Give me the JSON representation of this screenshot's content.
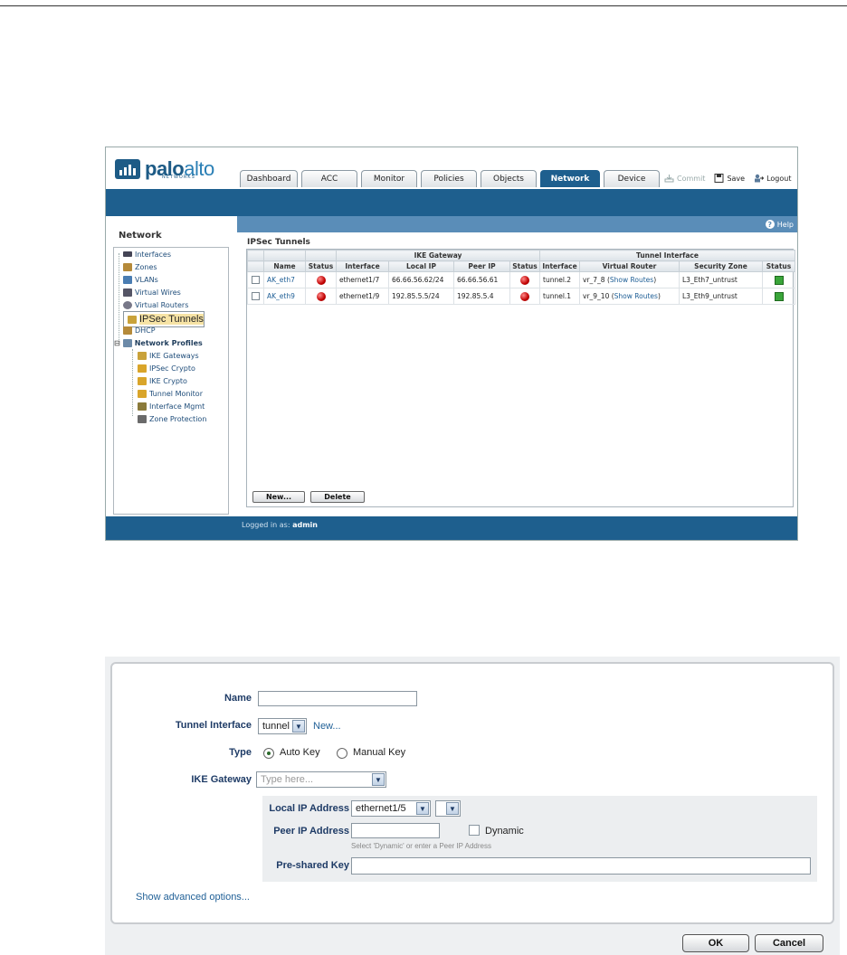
{
  "app": {
    "logo_main": "palo",
    "logo_accent": "alto",
    "logo_sub": "NETWORKS"
  },
  "tabs": [
    {
      "label": "Dashboard"
    },
    {
      "label": "ACC"
    },
    {
      "label": "Monitor"
    },
    {
      "label": "Policies"
    },
    {
      "label": "Objects"
    },
    {
      "label": "Network",
      "active": true
    },
    {
      "label": "Device"
    }
  ],
  "actions": {
    "commit": "Commit",
    "save": "Save",
    "logout": "Logout"
  },
  "help": "Help",
  "sidebar": {
    "title": "Network",
    "items": [
      {
        "label": "Interfaces"
      },
      {
        "label": "Zones"
      },
      {
        "label": "VLANs"
      },
      {
        "label": "Virtual Wires"
      },
      {
        "label": "Virtual Routers"
      },
      {
        "label": "IPSec Tunnels",
        "selected": true
      },
      {
        "label": "DHCP"
      },
      {
        "label": "Network Profiles",
        "group": true
      },
      {
        "label": "IKE Gateways"
      },
      {
        "label": "IPSec Crypto"
      },
      {
        "label": "IKE Crypto"
      },
      {
        "label": "Tunnel Monitor"
      },
      {
        "label": "Interface Mgmt"
      },
      {
        "label": "Zone Protection"
      }
    ]
  },
  "page": {
    "title": "IPSec Tunnels",
    "group_ike": "IKE Gateway",
    "group_tunnel": "Tunnel Interface",
    "columns": [
      "Name",
      "Status",
      "Interface",
      "Local IP",
      "Peer IP",
      "Status",
      "Interface",
      "Virtual Router",
      "Security Zone",
      "Status"
    ],
    "rows": [
      {
        "name": "AK_eth7",
        "ike_interface": "ethernet1/7",
        "local_ip": "66.66.56.62/24",
        "peer_ip": "66.66.56.61",
        "tunnel": "tunnel.2",
        "vr_name": "vr_7_8",
        "vr_link": "Show Routes",
        "zone": "L3_Eth7_untrust"
      },
      {
        "name": "AK_eth9",
        "ike_interface": "ethernet1/9",
        "local_ip": "192.85.5.5/24",
        "peer_ip": "192.85.5.4",
        "tunnel": "tunnel.1",
        "vr_name": "vr_9_10",
        "vr_link": "Show Routes",
        "zone": "L3_Eth9_untrust"
      }
    ],
    "new_button": "New...",
    "delete_button": "Delete"
  },
  "footer": {
    "prefix": "Logged in as:",
    "user": "admin"
  },
  "dialog": {
    "name_label": "Name",
    "name_value": "",
    "tunnel_label": "Tunnel Interface",
    "tunnel_value": "tunnel",
    "tunnel_new": "New...",
    "type_label": "Type",
    "type_auto": "Auto Key",
    "type_manual": "Manual Key",
    "ike_label": "IKE Gateway",
    "ike_placeholder": "Type here...",
    "local_ip_label": "Local IP Address",
    "local_ip_value": "ethernet1/5",
    "peer_ip_label": "Peer IP Address",
    "peer_ip_value": "",
    "dynamic_label": "Dynamic",
    "peer_hint": "Select 'Dynamic' or enter a Peer IP Address",
    "psk_label": "Pre-shared Key",
    "psk_value": "",
    "advanced_link": "Show advanced options...",
    "ok": "OK",
    "cancel": "Cancel"
  }
}
